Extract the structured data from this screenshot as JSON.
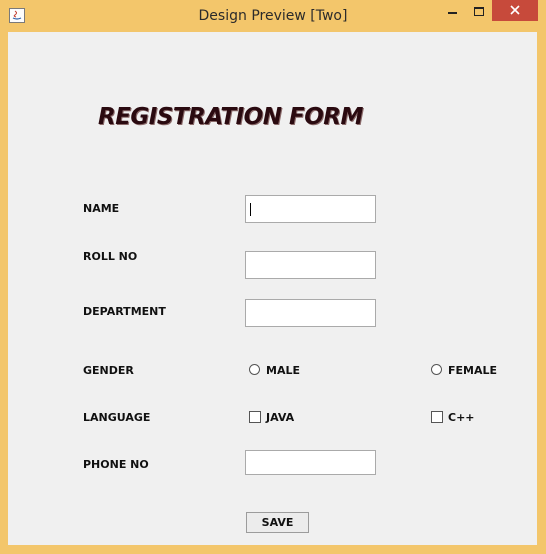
{
  "window": {
    "title": "Design Preview [Two]"
  },
  "form": {
    "heading": "REGISTRATION FORM",
    "name": {
      "label": "NAME",
      "value": ""
    },
    "roll_no": {
      "label": "ROLL NO",
      "value": ""
    },
    "department": {
      "label": "DEPARTMENT",
      "value": ""
    },
    "gender": {
      "label": "GENDER",
      "options": [
        "MALE",
        "FEMALE"
      ],
      "selected": null
    },
    "language": {
      "label": "LANGUAGE",
      "options": [
        "JAVA",
        "C++"
      ],
      "checked": []
    },
    "phone_no": {
      "label": "PHONE NO",
      "value": ""
    },
    "save_label": "SAVE"
  },
  "icons": {
    "app": "java-icon",
    "minimize": "minimize-icon",
    "maximize": "maximize-icon",
    "close": "close-icon"
  },
  "colors": {
    "frame": "#f3c66b",
    "close": "#c74a3b",
    "heading": "#2a0a10",
    "background": "#f0f0f0"
  }
}
